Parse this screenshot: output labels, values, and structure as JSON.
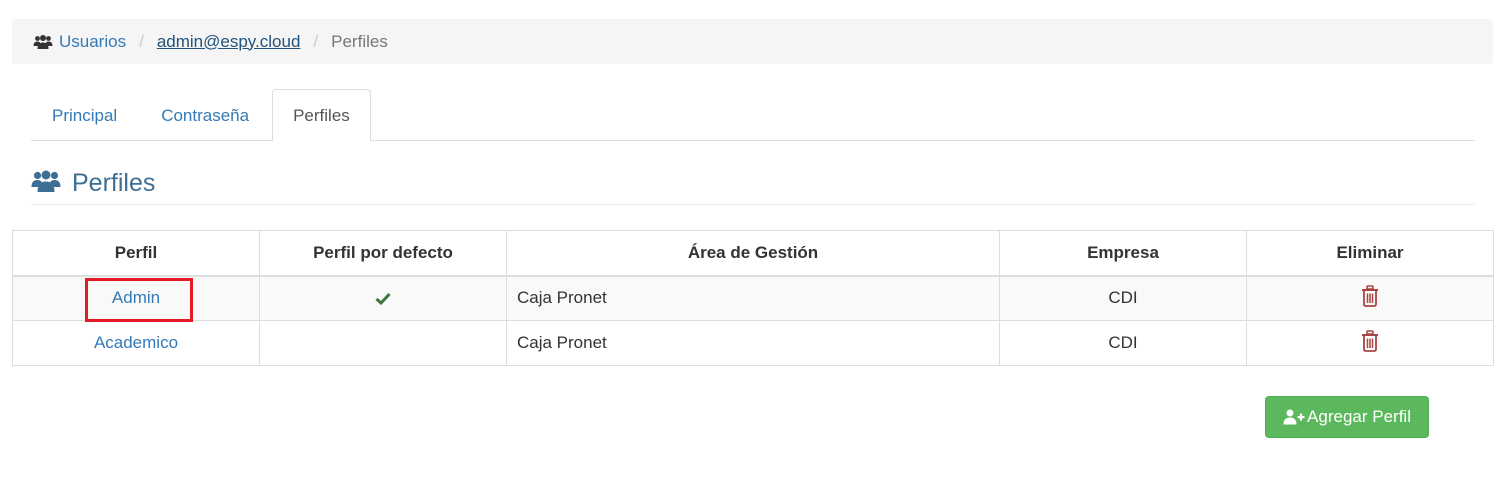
{
  "breadcrumb": {
    "icon": "users-icon",
    "items": [
      {
        "label": "Usuarios"
      },
      {
        "label": "admin@espy.cloud"
      },
      {
        "label": "Perfiles"
      }
    ],
    "separator": "/"
  },
  "tabs": [
    {
      "label": "Principal",
      "active": false
    },
    {
      "label": "Contraseña",
      "active": false
    },
    {
      "label": "Perfiles",
      "active": true
    }
  ],
  "section": {
    "icon": "users-icon",
    "title": "Perfiles"
  },
  "table": {
    "columns": [
      "Perfil",
      "Perfil por defecto",
      "Área de Gestión",
      "Empresa",
      "Eliminar"
    ],
    "rows": [
      {
        "perfil": "Admin",
        "default": true,
        "area": "Caja Pronet",
        "empresa": "CDI",
        "highlighted": true
      },
      {
        "perfil": "Academico",
        "default": false,
        "area": "Caja Pronet",
        "empresa": "CDI",
        "highlighted": false
      }
    ]
  },
  "add_button": {
    "label": "Agregar Perfil",
    "icon": "user-plus-icon"
  },
  "colors": {
    "link": "#337ab7",
    "success": "#5cb85c",
    "danger": "#a94442",
    "check": "#3c763d",
    "highlight": "#e01b24"
  }
}
